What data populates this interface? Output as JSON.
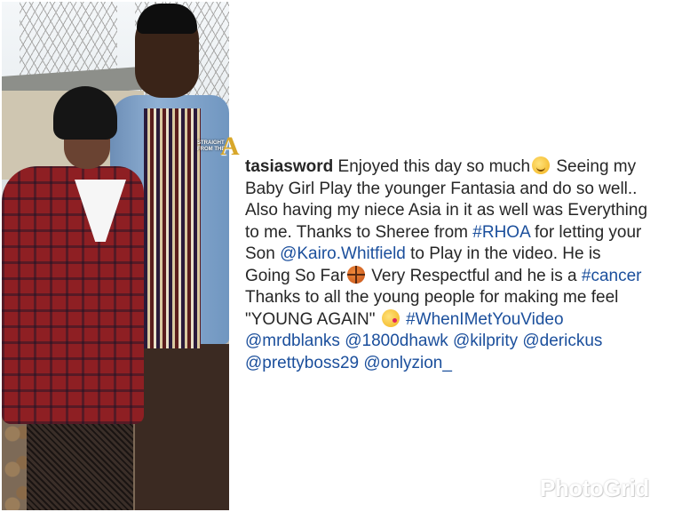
{
  "watermark": {
    "text": "STRAIGHT FROM THE",
    "logo_letter": "A"
  },
  "caption": {
    "username": "tasiasword",
    "lines": [
      "Enjoyed this day so much",
      "Seeing my",
      "Baby Girl Play the younger Fantasia and do so well..",
      "Also having my niece Asia in it as well was Everything",
      "to me. Thanks to Sheree from",
      "#RHOA",
      "for letting your",
      "Son",
      "@Kairo.Whitfield",
      "to Play in the video. He  is",
      "Going So Far",
      "Very Respectful and he is a",
      "#cancer",
      "Thanks to all the young people for making me feel",
      "\"YOUNG AGAIN\"",
      "#WhenIMetYouVideo",
      "@mrdblanks",
      "@1800dhawk",
      "@kilprity",
      "@derickus",
      "@prettyboss29",
      "@onlyzion_"
    ],
    "emojis": [
      "hugging-face",
      "basketball",
      "face-blowing-kiss"
    ]
  },
  "branding": {
    "photogrid": "PhotoGrid"
  },
  "colors": {
    "text": "#262626",
    "link": "#1b4f9c",
    "background": "#ffffff"
  }
}
